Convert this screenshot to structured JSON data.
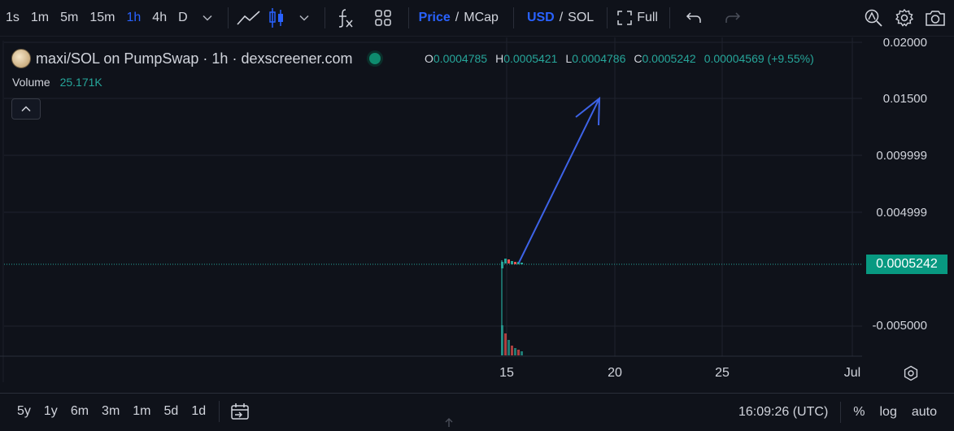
{
  "toolbar": {
    "timeframes": [
      "1s",
      "1m",
      "5m",
      "15m",
      "1h",
      "4h",
      "D"
    ],
    "active_timeframe": "1h",
    "price_label": "Price",
    "mcap_label": "MCap",
    "usd_label": "USD",
    "sol_label": "SOL",
    "full_label": "Full"
  },
  "legend": {
    "title": "maxi/SOL on PumpSwap · 1h · dexscreener.com",
    "o_label": "O",
    "o_value": "0.0004785",
    "h_label": "H",
    "h_value": "0.0005421",
    "l_label": "L",
    "l_value": "0.0004786",
    "c_label": "C",
    "c_value": "0.0005242",
    "change": "0.00004569 (+9.55%)",
    "volume_label": "Volume",
    "volume_value": "25.171K"
  },
  "price_axis": [
    "0.02000",
    "0.01500",
    "0.009999",
    "0.004999",
    "-0.005000"
  ],
  "current_price": "0.0005242",
  "time_axis": [
    "15",
    "20",
    "25",
    "Jul"
  ],
  "bottom": {
    "ranges": [
      "5y",
      "1y",
      "6m",
      "3m",
      "1m",
      "5d",
      "1d"
    ],
    "clock": "16:09:26 (UTC)",
    "percent_label": "%",
    "log_label": "log",
    "auto_label": "auto"
  },
  "colors": {
    "up": "#26a69a",
    "down": "#ef5350",
    "accent": "#2962ff",
    "arrow": "#3d63e8"
  }
}
